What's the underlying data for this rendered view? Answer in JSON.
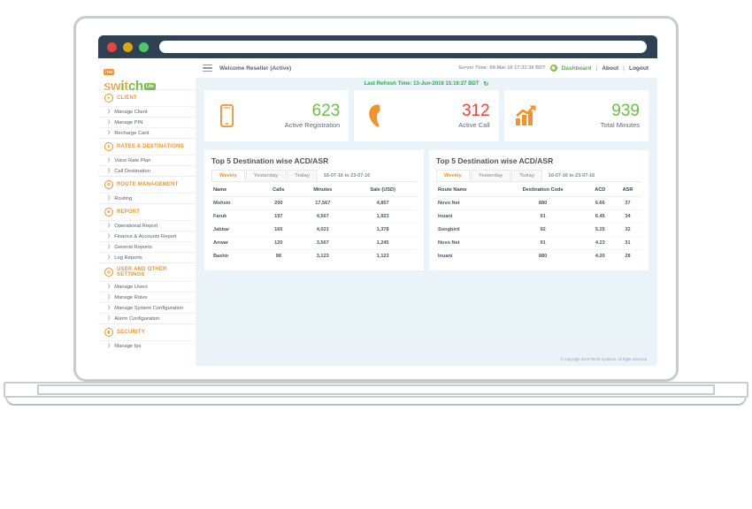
{
  "browser": {
    "address_value": ""
  },
  "brand": {
    "tag": "iTel",
    "name_part1": "sw",
    "name_part2": "i",
    "name_part3": "t",
    "name_part4": "ch",
    "lite": "Lite",
    "full_name": "iTel switch Lite"
  },
  "sidebar": {
    "sections": [
      {
        "label": "CLIENT",
        "icon": "user-icon",
        "glyph": "●",
        "items": [
          {
            "label": "Manage Client"
          },
          {
            "label": "Manage PIN"
          },
          {
            "label": "Recharge Card"
          }
        ]
      },
      {
        "label": "RATES & DESTINATIONS",
        "icon": "dollar-icon",
        "glyph": "$",
        "items": [
          {
            "label": "Voice Rate Plan"
          },
          {
            "label": "Call  Destination"
          }
        ]
      },
      {
        "label": "ROUTE MANAGEMENT",
        "icon": "gear-icon",
        "glyph": "⚙",
        "items": [
          {
            "label": "Routing"
          }
        ]
      },
      {
        "label": "REPORT",
        "icon": "chart-icon",
        "glyph": "■",
        "items": [
          {
            "label": "Operational Report"
          },
          {
            "label": "Finance & Accounts Report"
          },
          {
            "label": "General Reports"
          },
          {
            "label": "Log Reports"
          }
        ]
      },
      {
        "label": "USER AND OTHER SETTINGS",
        "icon": "settings-icon",
        "glyph": "◎",
        "items": [
          {
            "label": "Manage Users"
          },
          {
            "label": "Manage Roles"
          },
          {
            "label": "Manage System Configuration"
          },
          {
            "label": "Alarm Configuration"
          }
        ]
      },
      {
        "label": "SECURITY",
        "icon": "lock-icon",
        "glyph": "▮",
        "items": [
          {
            "label": "Manage Ips"
          }
        ]
      }
    ]
  },
  "topbar": {
    "welcome": "Welcome Reseller (Active)",
    "server_time": "Server Time: 09-Mar-16  17:31:38 BDT",
    "dashboard": "Dashboard",
    "about": "About",
    "logout": "Logout",
    "separator": "|"
  },
  "refresh": {
    "text": "Last Refresh Time: 13-Jun-2016 15:16:27 BDT",
    "icon": "refresh-icon"
  },
  "cards": [
    {
      "value": "623",
      "label": "Active Registration",
      "color": "green",
      "icon": "mobile-phone-icon"
    },
    {
      "value": "312",
      "label": "Active Call",
      "color": "red",
      "icon": "phone-handset-icon"
    },
    {
      "value": "939",
      "label": "Total Minutes",
      "color": "green",
      "icon": "bar-chart-arrow-icon"
    }
  ],
  "panel_left": {
    "title": "Top 5 Destination wise ACD/ASR",
    "tabs": [
      {
        "label": "Weekly",
        "active": true
      },
      {
        "label": "Yesterday",
        "active": false
      },
      {
        "label": "Today",
        "active": false
      }
    ],
    "date_range": "16-07-16 to 23-07-16",
    "columns": [
      "Name",
      "Calls",
      "Minutes",
      "Sale (USD)"
    ],
    "rows": [
      [
        "Mohsin",
        "200",
        "17,567",
        "4,857"
      ],
      [
        "Faruk",
        "197",
        "4,567",
        "1,923"
      ],
      [
        "Jabbar",
        "165",
        "4,021",
        "1,378"
      ],
      [
        "Anwar",
        "120",
        "3,567",
        "1,245"
      ],
      [
        "Bashir",
        "98",
        "3,123",
        "1,123"
      ]
    ]
  },
  "panel_right": {
    "title": "Top 5 Destination wise ACD/ASR",
    "tabs": [
      {
        "label": "Weekly",
        "active": true
      },
      {
        "label": "Yesterday",
        "active": false
      },
      {
        "label": "Today",
        "active": false
      }
    ],
    "date_range": "16-07-16 to 23-07-16",
    "columns": [
      "Route Name",
      "Destination Code",
      "ACD",
      "ASR"
    ],
    "rows": [
      [
        "Novo Net",
        "880",
        "6.66",
        "37"
      ],
      [
        "Inuani",
        "91",
        "6.45",
        "34"
      ],
      [
        "Songbird",
        "92",
        "5.25",
        "32"
      ],
      [
        "Novo Net",
        "91",
        "4.23",
        "31"
      ],
      [
        "Inuani",
        "880",
        "4.20",
        "28"
      ]
    ]
  },
  "footer": {
    "text": "© Copyright 2015 REVE Systems. All Right reserved"
  },
  "colors": {
    "accent_orange": "#f0932b",
    "green": "#6cc04a",
    "red": "#e8453c",
    "app_bg": "#eaf3f7",
    "titlebar": "#2f4254"
  }
}
